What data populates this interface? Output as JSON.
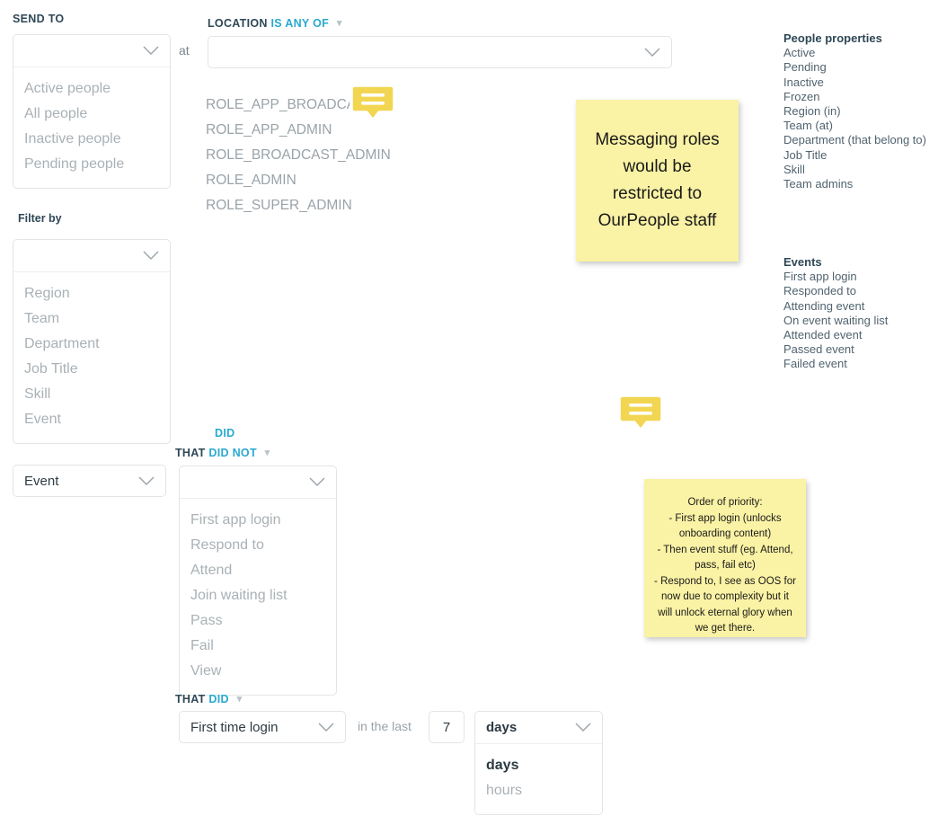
{
  "colors": {
    "accent_cyan": "#29a9cf",
    "label_dark": "#2e4756",
    "muted_grey": "#a9b1b6",
    "sticky_yellow": "#faf2a4",
    "bubble_yellow": "#f2d652",
    "border_grey": "#e2e5e7"
  },
  "send_to": {
    "label": "SEND TO",
    "selected_value": "",
    "placeholder": "",
    "options": [
      "Active people",
      "All people",
      "Inactive people",
      "Pending people"
    ]
  },
  "at_connector": "at",
  "location": {
    "label": "LOCATION",
    "operator": "IS ANY OF",
    "selected_value": "",
    "placeholder": ""
  },
  "roles": [
    "ROLE_APP_BROADCA",
    "ROLE_APP_ADMIN",
    "ROLE_BROADCAST_ADMIN",
    "ROLE_ADMIN",
    "ROLE_SUPER_ADMIN"
  ],
  "filter_by": {
    "label": "Filter by",
    "selected_value": "",
    "placeholder": "",
    "options": [
      "Region",
      "Team",
      "Department",
      "Job Title",
      "Skill",
      "Event"
    ]
  },
  "event_select": {
    "value": "Event"
  },
  "that_did_not": {
    "floating_option": "DID",
    "prefix": "THAT",
    "operator": "DID NOT",
    "selected_value": "",
    "placeholder": "",
    "options": [
      "First app login",
      "Respond to",
      "Attend",
      "Join waiting list",
      "Pass",
      "Fail",
      "View"
    ]
  },
  "that_did": {
    "prefix": "THAT",
    "operator": "DID",
    "action_value": "First time login",
    "in_the_last_label": "in the last",
    "amount": "7",
    "unit_value": "days",
    "unit_options": [
      "days",
      "hours"
    ]
  },
  "reference": {
    "people_properties": {
      "title": "People properties",
      "items": [
        "Active",
        "Pending",
        "Inactive",
        "Frozen",
        "Region (in)",
        "Team (at)",
        "Department (that belong to)",
        "Job Title",
        "Skill",
        "Team admins"
      ]
    },
    "events": {
      "title": "Events",
      "items": [
        "First app login",
        "Responded to",
        "Attending event",
        "On event waiting list",
        "Attended event",
        "Passed event",
        "Failed event"
      ]
    }
  },
  "sticky_notes": [
    {
      "id": "roles-note",
      "text": "Messaging roles would be restricted to OurPeople staff"
    },
    {
      "id": "priority-note",
      "text": "Order of priority:\n- First app login (unlocks onboarding content)\n- Then event stuff (eg. Attend, pass, fail etc)\n- Respond to, I see as OOS for now due to complexity but it will unlock eternal glory when we get there."
    }
  ]
}
